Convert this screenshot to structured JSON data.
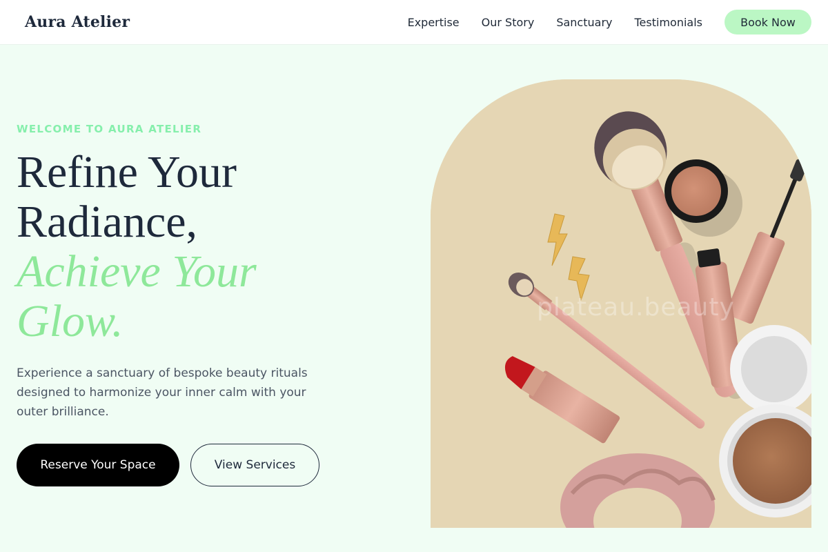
{
  "header": {
    "logo": "Aura Atelier",
    "nav": [
      "Expertise",
      "Our Story",
      "Sanctuary",
      "Testimonials"
    ],
    "cta_label": "Book Now"
  },
  "hero": {
    "eyebrow": "WELCOME TO AURA ATELIER",
    "headline_line1": "Refine Your",
    "headline_line2": "Radiance,",
    "headline_accent1": "Achieve Your",
    "headline_accent2": "Glow.",
    "description": "Experience a sanctuary of bespoke beauty rituals designed to harmonize your inner calm with your outer brilliance.",
    "primary_button": "Reserve Your Space",
    "secondary_button": "View Services"
  },
  "image": {
    "watermark": "plateau.beauty"
  },
  "colors": {
    "background": "#f0fdf4",
    "accent_green": "#86efac",
    "book_button": "#bbf7c4",
    "text_dark": "#1e293b",
    "image_background": "#e5d6b4"
  }
}
